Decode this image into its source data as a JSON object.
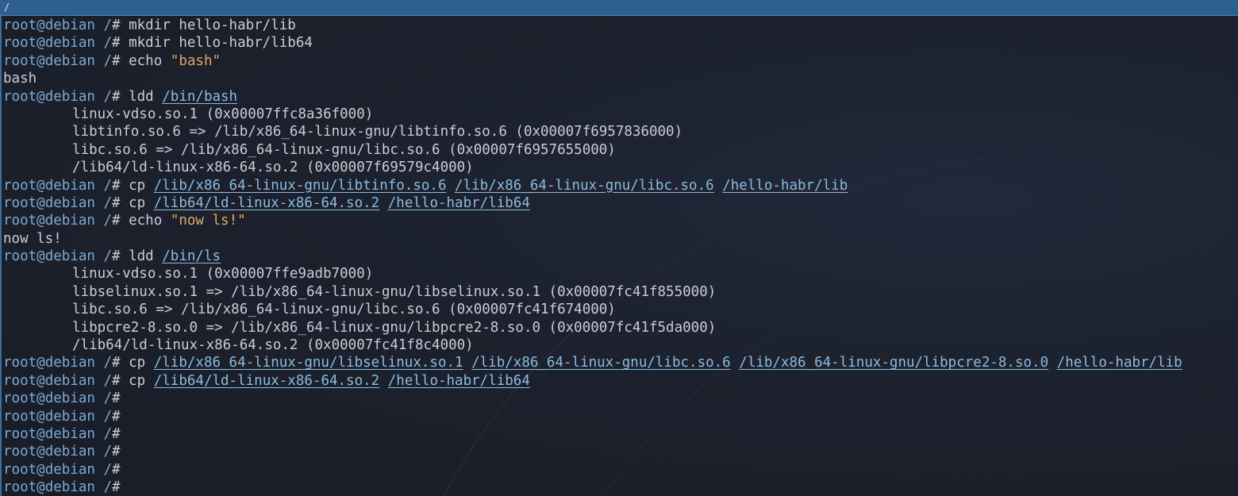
{
  "title_bar": {
    "text": "/"
  },
  "prompt": {
    "user": "root",
    "at": "@",
    "host": "debian",
    "cwd": "/",
    "symbol": "#"
  },
  "lines": [
    {
      "type": "cmd",
      "cmd": "mkdir hello-habr/lib"
    },
    {
      "type": "cmd",
      "cmd": "mkdir hello-habr/lib64"
    },
    {
      "type": "cmd",
      "cmd": "echo",
      "str": "\"bash\""
    },
    {
      "type": "out",
      "text": "bash"
    },
    {
      "type": "cmd",
      "cmd": "ldd",
      "paths": [
        "/bin/bash"
      ]
    },
    {
      "type": "out",
      "indent": true,
      "text": "linux-vdso.so.1 (0x00007ffc8a36f000)"
    },
    {
      "type": "out",
      "indent": true,
      "text": "libtinfo.so.6 => /lib/x86_64-linux-gnu/libtinfo.so.6 (0x00007f6957836000)"
    },
    {
      "type": "out",
      "indent": true,
      "text": "libc.so.6 => /lib/x86_64-linux-gnu/libc.so.6 (0x00007f6957655000)"
    },
    {
      "type": "out",
      "indent": true,
      "text": "/lib64/ld-linux-x86-64.so.2 (0x00007f69579c4000)"
    },
    {
      "type": "cmd",
      "cmd": "cp",
      "paths": [
        "/lib/x86_64-linux-gnu/libtinfo.so.6",
        "/lib/x86_64-linux-gnu/libc.so.6",
        "/hello-habr/lib"
      ]
    },
    {
      "type": "cmd",
      "cmd": "cp",
      "paths": [
        "/lib64/ld-linux-x86-64.so.2",
        "/hello-habr/lib64"
      ]
    },
    {
      "type": "cmd",
      "cmd": "echo",
      "str": "\"now ls!\""
    },
    {
      "type": "out",
      "text": "now ls!"
    },
    {
      "type": "cmd",
      "cmd": "ldd",
      "paths": [
        "/bin/ls"
      ]
    },
    {
      "type": "out",
      "indent": true,
      "text": "linux-vdso.so.1 (0x00007ffe9adb7000)"
    },
    {
      "type": "out",
      "indent": true,
      "text": "libselinux.so.1 => /lib/x86_64-linux-gnu/libselinux.so.1 (0x00007fc41f855000)"
    },
    {
      "type": "out",
      "indent": true,
      "text": "libc.so.6 => /lib/x86_64-linux-gnu/libc.so.6 (0x00007fc41f674000)"
    },
    {
      "type": "out",
      "indent": true,
      "text": "libpcre2-8.so.0 => /lib/x86_64-linux-gnu/libpcre2-8.so.0 (0x00007fc41f5da000)"
    },
    {
      "type": "out",
      "indent": true,
      "text": "/lib64/ld-linux-x86-64.so.2 (0x00007fc41f8c4000)"
    },
    {
      "type": "cmd",
      "cmd": "cp",
      "paths": [
        "/lib/x86_64-linux-gnu/libselinux.so.1",
        "/lib/x86_64-linux-gnu/libc.so.6",
        "/lib/x86_64-linux-gnu/libpcre2-8.so.0",
        "/hello-habr/lib"
      ]
    },
    {
      "type": "cmd",
      "cmd": "cp",
      "paths": [
        "/lib64/ld-linux-x86-64.so.2",
        "/hello-habr/lib64"
      ]
    },
    {
      "type": "cmd"
    },
    {
      "type": "cmd"
    },
    {
      "type": "cmd"
    },
    {
      "type": "cmd"
    },
    {
      "type": "cmd"
    },
    {
      "type": "cmd"
    }
  ]
}
